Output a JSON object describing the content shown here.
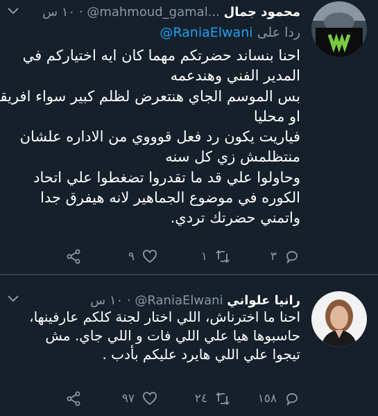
{
  "tweets": [
    {
      "name": "محمود جمال",
      "handle": "@mahmoud_gamal...",
      "time": "١٠ س",
      "reply_prefix": "ردا على",
      "reply_to": "@RaniaElwani",
      "lines": [
        "احنا بنساند حضرتكم مهما كان ايه اختياركم في",
        "المدير الفني وهندعمه",
        "بس الموسم الجاي هنتعرض لظلم كبير سواء افريقيا",
        "او محليا",
        "فياريت يكون رد فعل قوووي من الاداره علشان",
        "منتظلمش زي كل سنه",
        "وحاولوا علي قد ما تقدروا تضغطوا علي اتحاد",
        "الكوره في موضوع الجماهير لانه هيفرق جدا",
        "واتمني حضرتك تردي."
      ],
      "stats": {
        "replies": "٣",
        "retweets": "١",
        "likes": "٩"
      }
    },
    {
      "name": "رانيا علواني",
      "handle": "@RaniaElwani",
      "time": "١٠ س",
      "lines": [
        "احنا ما اخترناش، اللي اختار لجنة كلكم عارفينها،",
        "حاسبوها هيا علي اللي فات و اللي جاي.   مش",
        "تيجوا علي اللي هايرد عليكم بأدب ."
      ],
      "stats": {
        "replies": "١٥٨",
        "retweets": "٢٤",
        "likes": "٩٧"
      }
    }
  ]
}
